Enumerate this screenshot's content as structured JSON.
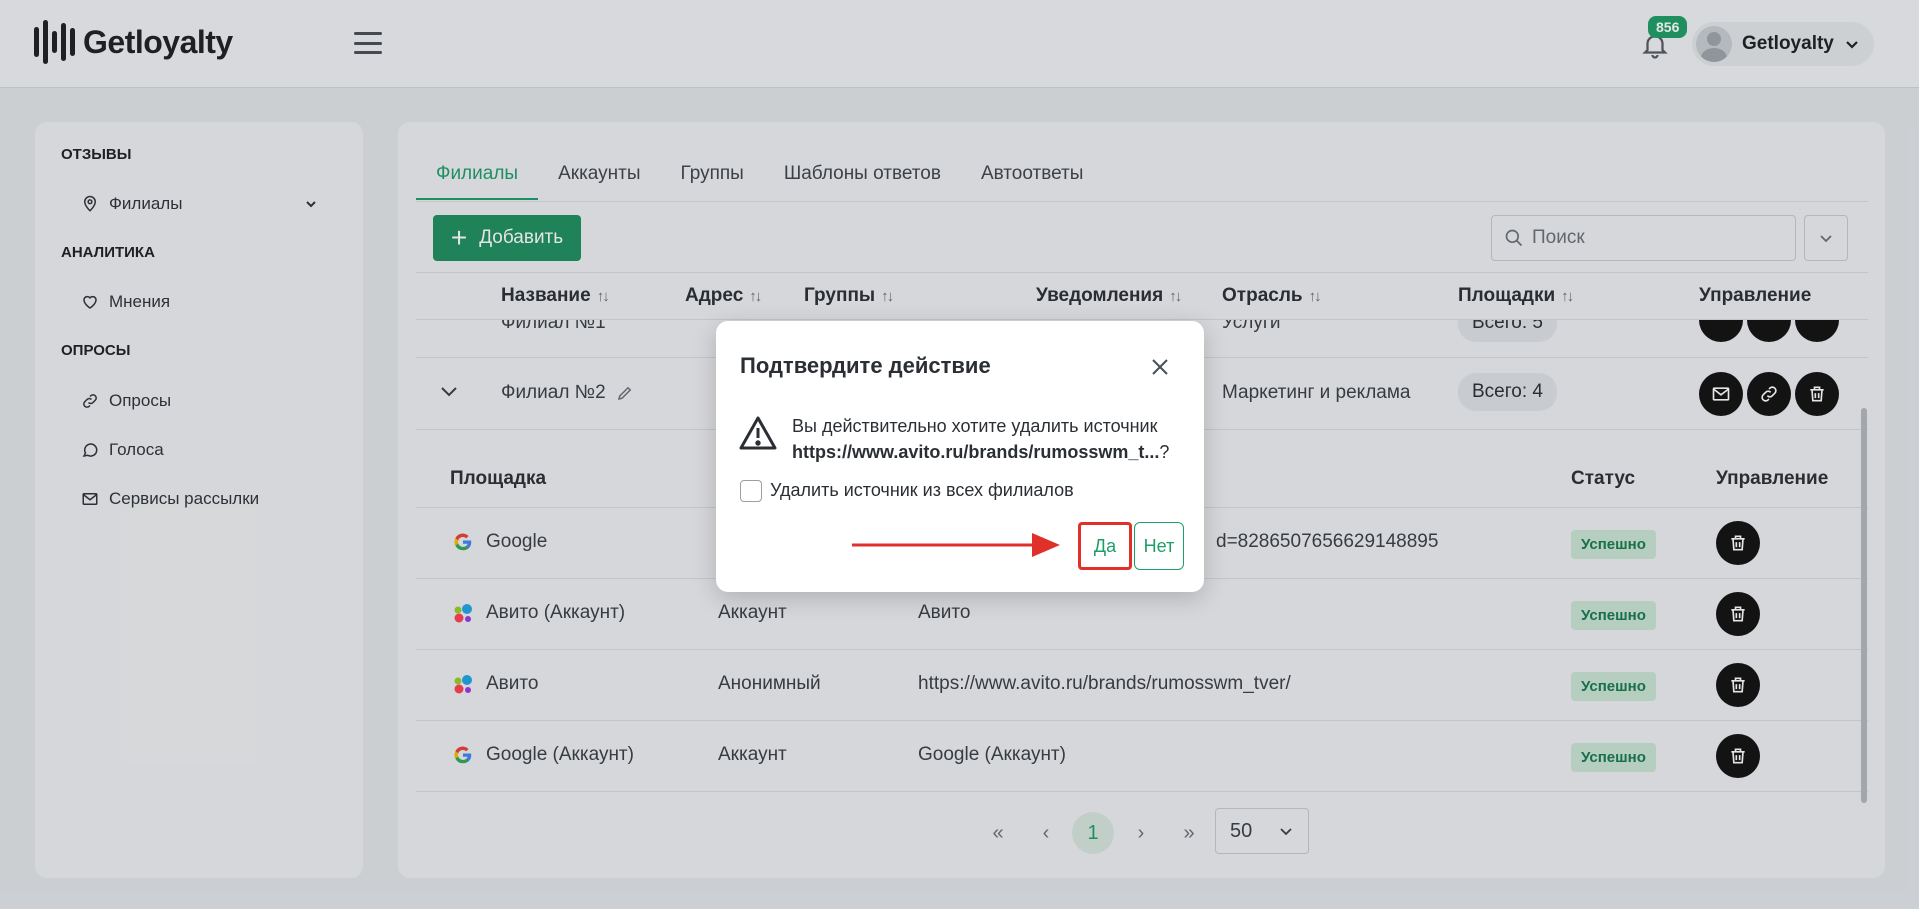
{
  "header": {
    "logo_text": "Getloyalty",
    "notification_count": "856",
    "user_name": "Getloyalty"
  },
  "sidebar": {
    "sections": [
      {
        "title": "ОТЗЫВЫ",
        "items": [
          {
            "label": "Филиалы",
            "icon": "location-pin-icon",
            "expandable": true
          }
        ]
      },
      {
        "title": "АНАЛИТИКА",
        "items": [
          {
            "label": "Мнения",
            "icon": "heart-icon"
          }
        ]
      },
      {
        "title": "ОПРОСЫ",
        "items": [
          {
            "label": "Опросы",
            "icon": "link-icon"
          },
          {
            "label": "Голоса",
            "icon": "chat-bubble-icon"
          },
          {
            "label": "Сервисы рассылки",
            "icon": "mail-icon"
          }
        ]
      }
    ]
  },
  "tabs": [
    {
      "label": "Филиалы",
      "active": true
    },
    {
      "label": "Аккаунты"
    },
    {
      "label": "Группы"
    },
    {
      "label": "Шаблоны ответов"
    },
    {
      "label": "Автоответы"
    }
  ],
  "toolbar": {
    "add_label": "Добавить",
    "search_placeholder": "Поиск"
  },
  "table": {
    "columns": [
      "Название",
      "Адрес",
      "Группы",
      "Уведомления",
      "Отрасль",
      "Площадки",
      "Управление"
    ],
    "rows": [
      {
        "name": "Филиал №1",
        "industry": "Услуги",
        "platforms": "Всего: 5"
      },
      {
        "name": "Филиал №2",
        "industry": "Маркетинг и реклама",
        "platforms": "Всего: 4"
      }
    ]
  },
  "sources": {
    "columns": {
      "platform": "Площадка",
      "status": "Статус",
      "manage": "Управление"
    },
    "rows": [
      {
        "platform": "Google",
        "icon": "google-icon",
        "type": "",
        "link": "d=8286507656629148895",
        "status": "Успешно"
      },
      {
        "platform": "Авито (Аккаунт)",
        "icon": "avito-icon",
        "type": "Аккаунт",
        "link": "Авито",
        "status": "Успешно"
      },
      {
        "platform": "Авито",
        "icon": "avito-icon",
        "type": "Анонимный",
        "link": "https://www.avito.ru/brands/rumosswm_tver/",
        "status": "Успешно"
      },
      {
        "platform": "Google (Аккаунт)",
        "icon": "google-icon",
        "type": "Аккаунт",
        "link": "Google (Аккаунт)",
        "status": "Успешно"
      }
    ]
  },
  "pagination": {
    "first": "«",
    "prev": "‹",
    "current": "1",
    "next": "›",
    "last": "»",
    "per_page": "50"
  },
  "modal": {
    "title": "Подтвердите действие",
    "message": "Вы действительно хотите удалить источник",
    "source": "https://www.avito.ru/brands/rumosswm_t...",
    "suffix": "?",
    "checkbox_label": "Удалить источник из всех филиалов",
    "yes_label": "Да",
    "no_label": "Нет"
  },
  "colors": {
    "accent": "#1e9e67",
    "highlight": "#e0302a"
  }
}
